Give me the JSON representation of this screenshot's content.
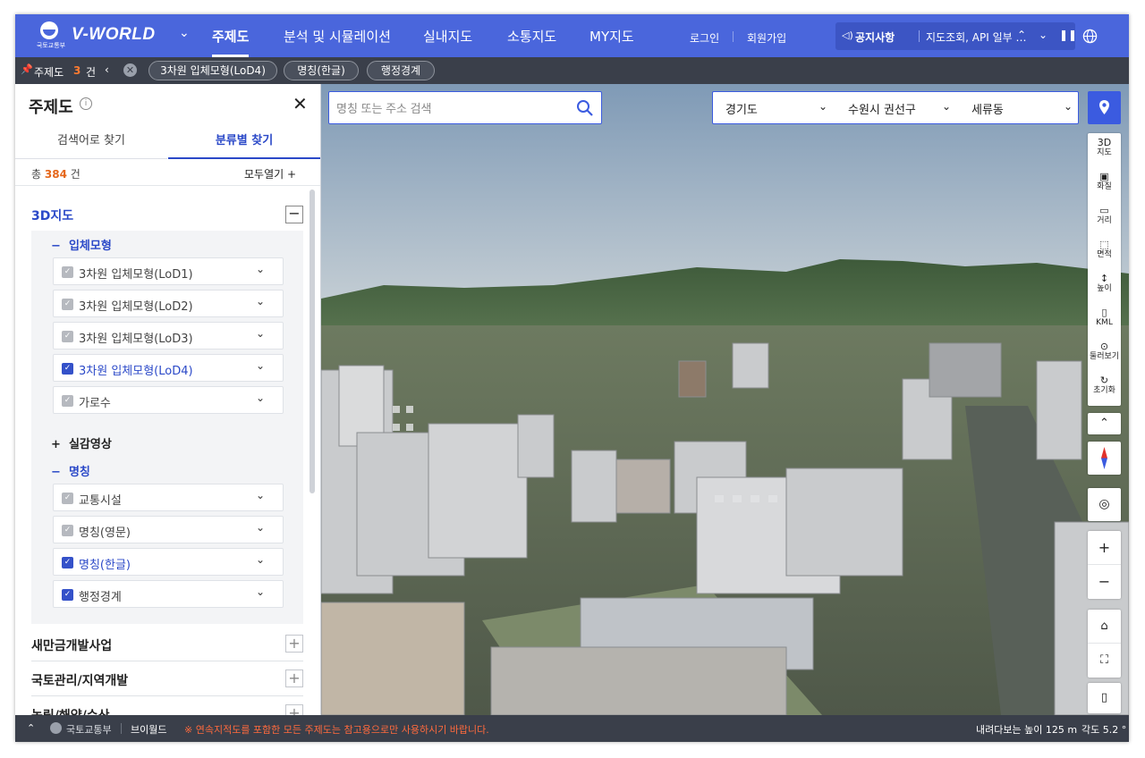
{
  "nav": {
    "logo_text": "국토교통부",
    "brand": "V-WORLD",
    "menu": [
      "주제도",
      "분석 및 시뮬레이션",
      "실내지도",
      "소통지도",
      "MY지도"
    ],
    "login": "로그인",
    "signup": "회원가입",
    "notice_label": "공지사항",
    "notice_text": "지도조회, API 일부 …"
  },
  "tagbar": {
    "title": "주제도",
    "count": "3",
    "unit": "건",
    "tags": [
      "3차원 입체모형(LoD4)",
      "명칭(한글)",
      "행정경계"
    ]
  },
  "panel": {
    "title": "주제도",
    "tabs": [
      "검색어로 찾기",
      "분류별 찾기"
    ],
    "total_prefix": "총",
    "total_count": "384",
    "total_unit": "건",
    "open_all": "모두열기 +",
    "category_3d": "3D지도",
    "sub_model": "입체모형",
    "model_items": [
      {
        "label": "3차원 입체모형(LoD1)",
        "checked": false
      },
      {
        "label": "3차원 입체모형(LoD2)",
        "checked": false
      },
      {
        "label": "3차원 입체모형(LoD3)",
        "checked": false
      },
      {
        "label": "3차원 입체모형(LoD4)",
        "checked": true
      },
      {
        "label": "가로수",
        "checked": false
      }
    ],
    "sub_image": "실감영상",
    "sub_name": "명칭",
    "name_items": [
      {
        "label": "교통시설",
        "checked": false
      },
      {
        "label": "명칭(영문)",
        "checked": false
      },
      {
        "label": "명칭(한글)",
        "checked": true
      },
      {
        "label": "행정경계",
        "checked": true
      }
    ],
    "categories": [
      "새만금개발사업",
      "국토관리/지역개발",
      "농림/해양/수산"
    ]
  },
  "map": {
    "search_placeholder": "명칭 또는 주소 검색",
    "region": [
      "경기도",
      "수원시 권선구",
      "세류동"
    ],
    "tools": [
      {
        "icon": "3d-icon",
        "label": "3D\n지도"
      },
      {
        "icon": "capture-icon",
        "label": "화질"
      },
      {
        "icon": "ruler-icon",
        "label": "거리"
      },
      {
        "icon": "area-icon",
        "label": "면적"
      },
      {
        "icon": "height-icon",
        "label": "높이"
      },
      {
        "icon": "kml-icon",
        "label": "KML"
      },
      {
        "icon": "look-around-icon",
        "label": "둘러보기"
      },
      {
        "icon": "reset-icon",
        "label": "초기화"
      }
    ]
  },
  "status": {
    "ministry": "국토교통부",
    "vworld": "브이월드",
    "warning": "※ 연속지적도를 포함한 모든 주제도는 참고용으로만 사용하시기 바랍니다.",
    "height": "내려다보는 높이 125 m",
    "angle": "각도 5.2 °"
  },
  "colors": {
    "primary": "#4a66dc",
    "accent": "#2b49c8",
    "dark_bar": "#3a3f4a",
    "warn": "#ff6a3d",
    "count": "#e5671b"
  }
}
